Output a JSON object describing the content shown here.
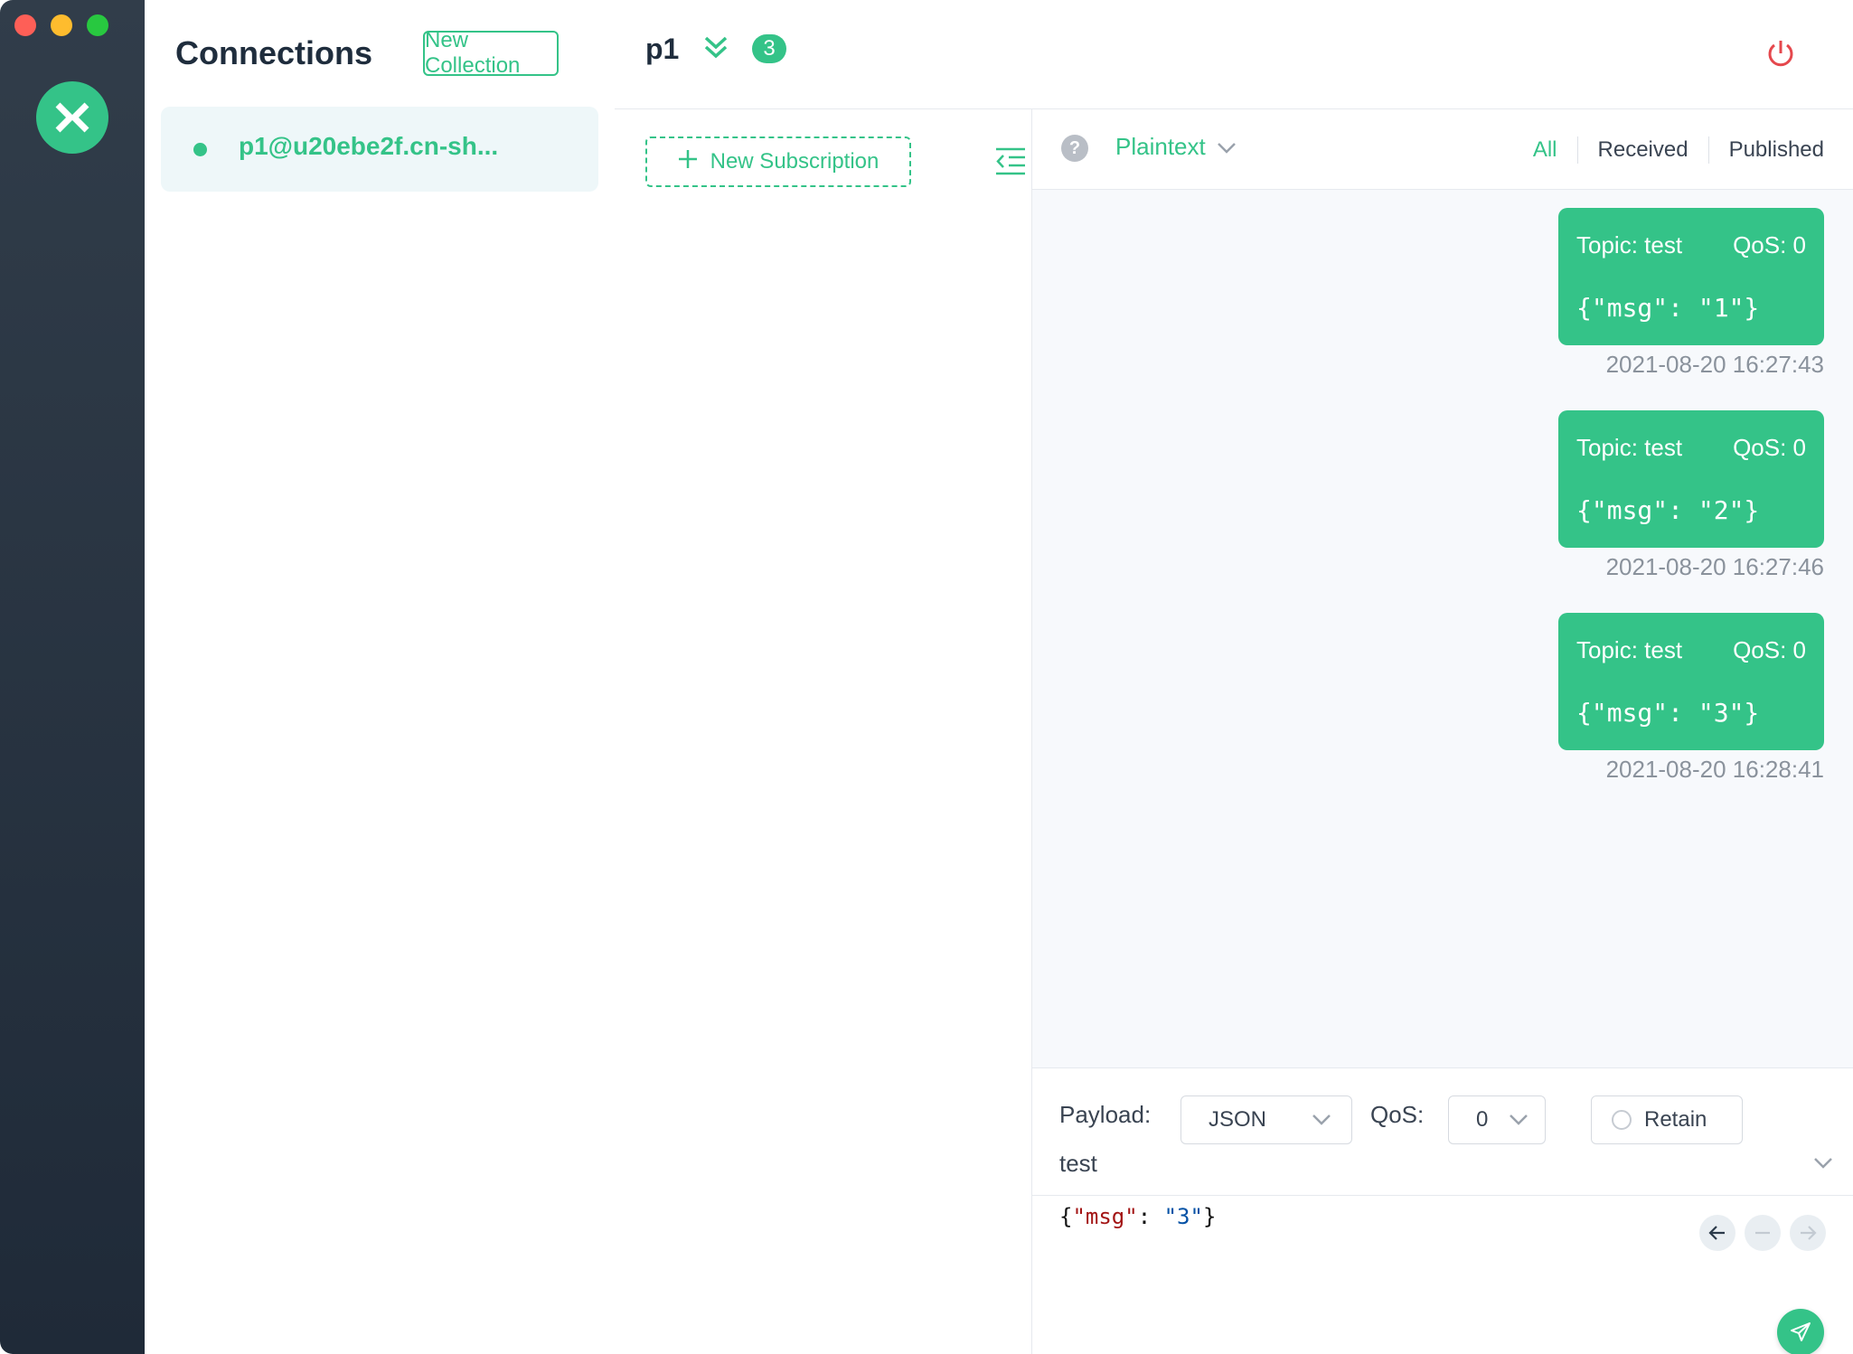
{
  "colors": {
    "accent": "#34c388",
    "rail_top": "#313d4a",
    "rail_bottom": "#1f2a38",
    "danger": "#e5484d"
  },
  "connections": {
    "title": "Connections",
    "new_collection_label": "New Collection",
    "items": [
      {
        "name": "p1@u20ebe2f.cn-sh...",
        "status": "connected"
      }
    ]
  },
  "header": {
    "connection_name": "p1",
    "message_count": "3"
  },
  "subscriptions": {
    "new_subscription_label": "New Subscription"
  },
  "messages": {
    "format": "Plaintext",
    "help_glyph": "?",
    "filters": {
      "all": "All",
      "received": "Received",
      "published": "Published",
      "active": "All"
    },
    "items": [
      {
        "topic": "Topic: test",
        "qos": "QoS: 0",
        "payload": "{\"msg\": \"1\"}",
        "time": "2021-08-20 16:27:43"
      },
      {
        "topic": "Topic: test",
        "qos": "QoS: 0",
        "payload": "{\"msg\": \"2\"}",
        "time": "2021-08-20 16:27:46"
      },
      {
        "topic": "Topic: test",
        "qos": "QoS: 0",
        "payload": "{\"msg\": \"3\"}",
        "time": "2021-08-20 16:28:41"
      }
    ]
  },
  "publish": {
    "payload_label": "Payload:",
    "payload_format": "JSON",
    "qos_label": "QoS:",
    "qos_value": "0",
    "retain_label": "Retain",
    "topic": "test",
    "editor": {
      "open": "{",
      "key": "\"msg\"",
      "colon": ": ",
      "value": "\"3\"",
      "close": "}"
    }
  }
}
